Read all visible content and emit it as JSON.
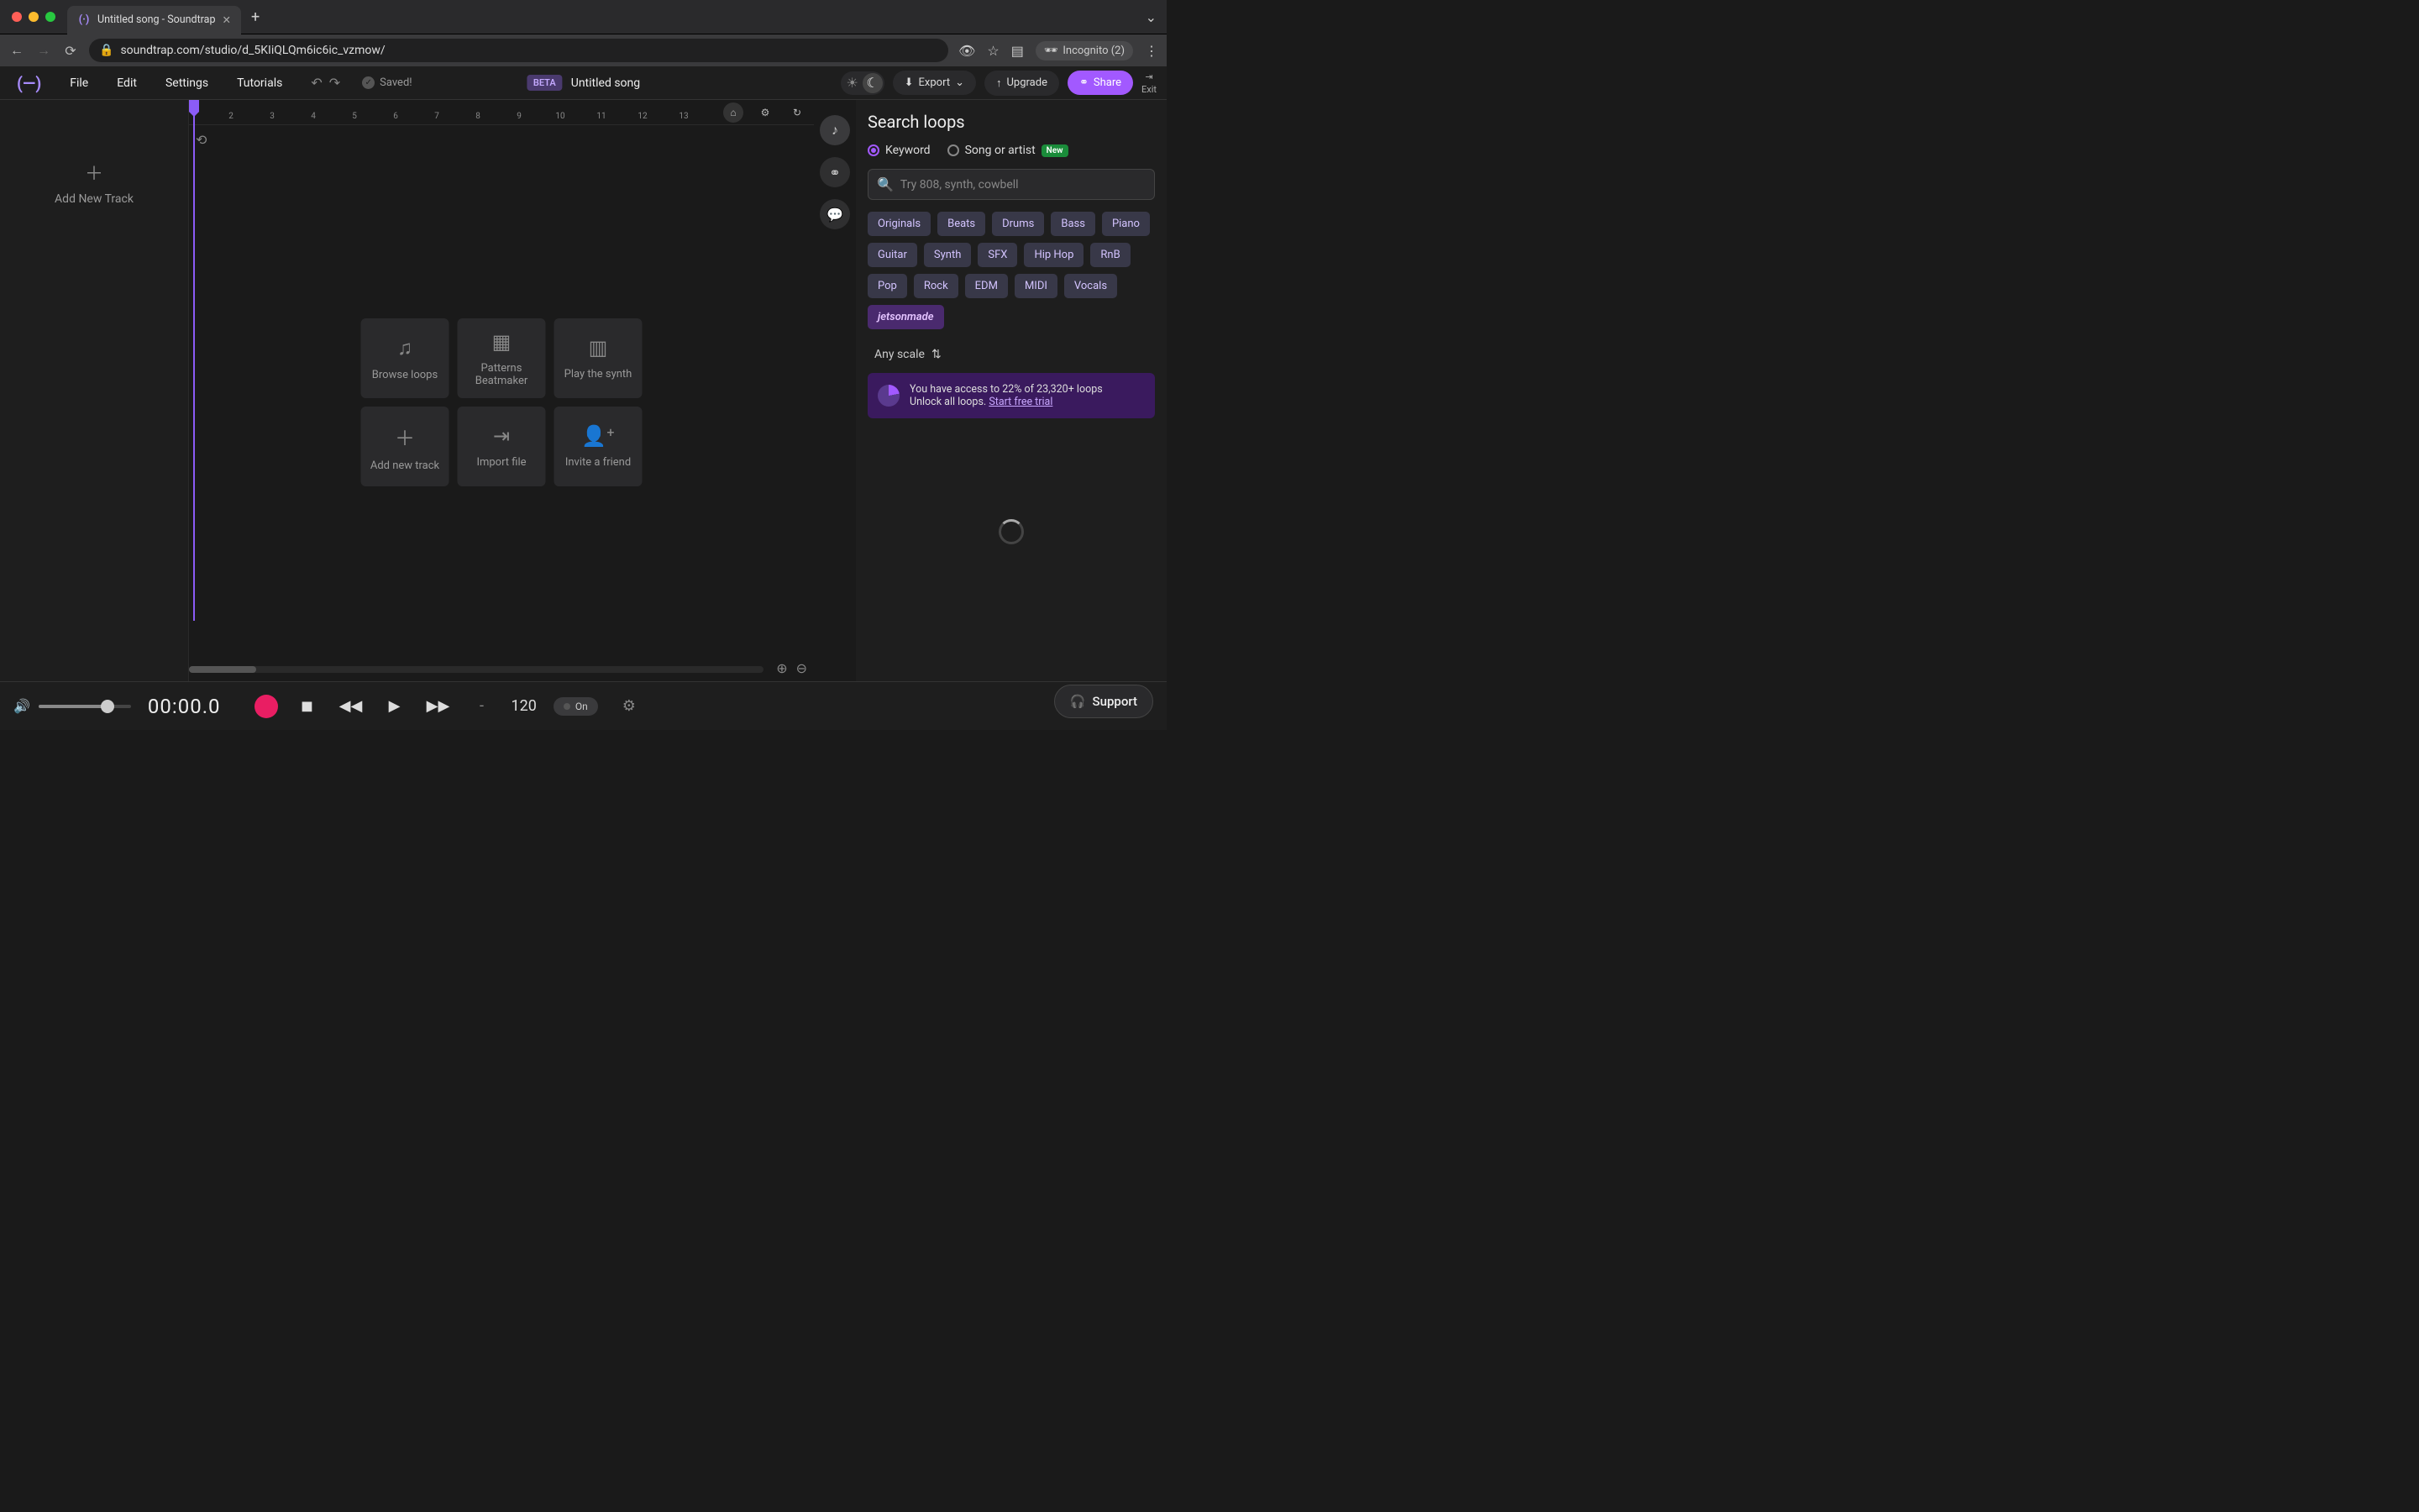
{
  "browser": {
    "tab_title": "Untitled song - Soundtrap",
    "url": "soundtrap.com/studio/d_5KIiQLQm6ic6ic_vzmow/",
    "incognito_label": "Incognito (2)"
  },
  "header": {
    "menus": [
      "File",
      "Edit",
      "Settings",
      "Tutorials"
    ],
    "saved_label": "Saved!",
    "beta_label": "BETA",
    "song_title": "Untitled song",
    "export_label": "Export",
    "upgrade_label": "Upgrade",
    "share_label": "Share",
    "exit_label": "Exit"
  },
  "track_panel": {
    "add_track_label": "Add New Track"
  },
  "ruler": {
    "ticks": [
      "2",
      "3",
      "4",
      "5",
      "6",
      "7",
      "8",
      "9",
      "10",
      "11",
      "12",
      "13"
    ]
  },
  "action_cards": [
    {
      "label": "Browse loops",
      "icon": "music-note-icon"
    },
    {
      "label": "Patterns Beatmaker",
      "icon": "grid-icon"
    },
    {
      "label": "Play the synth",
      "icon": "piano-icon"
    },
    {
      "label": "Add new track",
      "icon": "plus-icon"
    },
    {
      "label": "Import file",
      "icon": "import-icon"
    },
    {
      "label": "Invite a friend",
      "icon": "add-person-icon"
    }
  ],
  "loops_panel": {
    "title": "Search loops",
    "radio_keyword": "Keyword",
    "radio_song": "Song or artist",
    "new_badge": "New",
    "search_placeholder": "Try 808, synth, cowbell",
    "tags": [
      "Originals",
      "Beats",
      "Drums",
      "Bass",
      "Piano",
      "Guitar",
      "Synth",
      "SFX",
      "Hip Hop",
      "RnB",
      "Pop",
      "Rock",
      "EDM",
      "MIDI",
      "Vocals",
      "jetsonmade"
    ],
    "scale_label": "Any scale",
    "access_text": "You have access to 22% of 23,320+ loops",
    "unlock_text": "Unlock all loops.",
    "trial_link": "Start free trial"
  },
  "transport": {
    "timecode": "00:00.0",
    "key": "-",
    "tempo": "120",
    "metronome_label": "On"
  },
  "support_label": "Support"
}
